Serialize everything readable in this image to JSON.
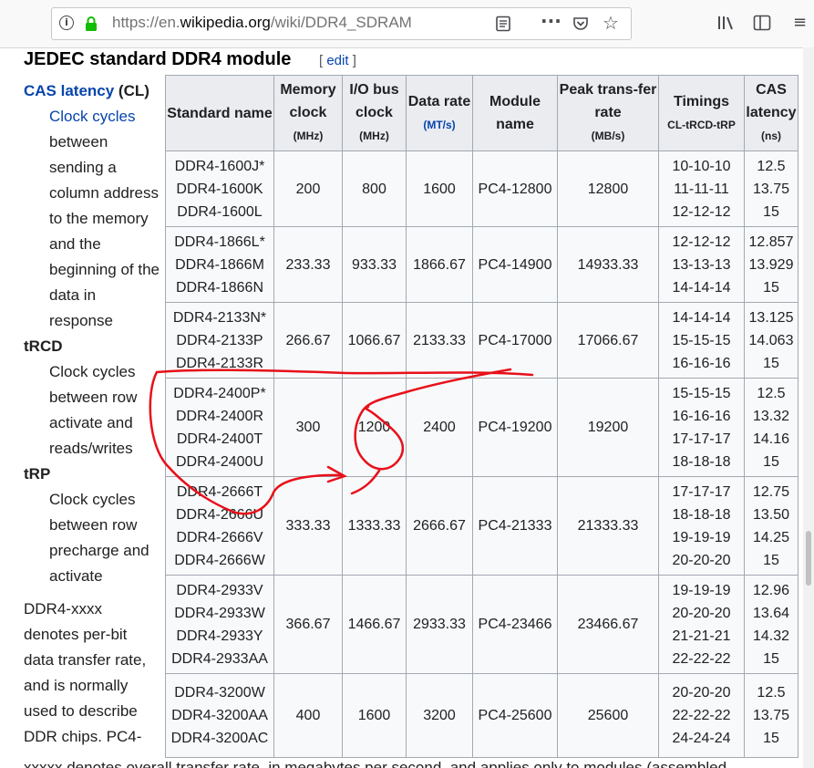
{
  "browser": {
    "url_prefix": "https://en.",
    "url_domain": "wikipedia.org",
    "url_path": "/wiki/DDR4_SDRAM"
  },
  "section": {
    "title": "JEDEC standard DDR4 module",
    "edit_open": "[ ",
    "edit_label": "edit",
    "edit_close": " ]"
  },
  "sidebar": {
    "cas_link": "CAS latency",
    "cas_abbr": " (CL)",
    "cas_desc_link": "Clock cycles",
    "cas_desc": "between sending a column address to the memory and the beginning of the data in response",
    "trcd_term": "tRCD",
    "trcd_desc": "Clock cycles between row activate and reads/writes",
    "trp_term": "tRP",
    "trp_desc": "Clock cycles between row precharge and activate",
    "note": "DDR4-xxxx denotes per-bit data transfer rate, and is normally used to describe DDR chips. PC4-",
    "bottom_cut": "xxxxx denotes overall transfer rate, in megabytes per second, and applies only to modules (assembled"
  },
  "table": {
    "headers": [
      {
        "label": "Standard name",
        "unit": ""
      },
      {
        "label": "Memory clock",
        "unit": "(MHz)"
      },
      {
        "label": "I/O bus clock",
        "unit": "(MHz)"
      },
      {
        "label": "Data rate",
        "unit": "(MT/s)"
      },
      {
        "label": "Module name",
        "unit": ""
      },
      {
        "label": "Peak trans-fer rate",
        "unit": "(MB/s)"
      },
      {
        "label": "Timings",
        "unit": "CL-tRCD-tRP"
      },
      {
        "label": "CAS latency",
        "unit": "(ns)"
      }
    ],
    "rows": [
      {
        "standard": [
          "DDR4-1600J*",
          "DDR4-1600K",
          "DDR4-1600L"
        ],
        "memory_clock": "200",
        "io_clock": "800",
        "data_rate": "1600",
        "module": "PC4-12800",
        "peak": "12800",
        "timings": [
          "10-10-10",
          "11-11-11",
          "12-12-12"
        ],
        "cas": [
          "12.5",
          "13.75",
          "15"
        ]
      },
      {
        "standard": [
          "DDR4-1866L*",
          "DDR4-1866M",
          "DDR4-1866N"
        ],
        "memory_clock": "233.33",
        "io_clock": "933.33",
        "data_rate": "1866.67",
        "module": "PC4-14900",
        "peak": "14933.33",
        "timings": [
          "12-12-12",
          "13-13-13",
          "14-14-14"
        ],
        "cas": [
          "12.857",
          "13.929",
          "15"
        ]
      },
      {
        "standard": [
          "DDR4-2133N*",
          "DDR4-2133P",
          "DDR4-2133R"
        ],
        "memory_clock": "266.67",
        "io_clock": "1066.67",
        "data_rate": "2133.33",
        "module": "PC4-17000",
        "peak": "17066.67",
        "timings": [
          "14-14-14",
          "15-15-15",
          "16-16-16"
        ],
        "cas": [
          "13.125",
          "14.063",
          "15"
        ]
      },
      {
        "standard": [
          "DDR4-2400P*",
          "DDR4-2400R",
          "DDR4-2400T",
          "DDR4-2400U"
        ],
        "memory_clock": "300",
        "io_clock": "1200",
        "data_rate": "2400",
        "module": "PC4-19200",
        "peak": "19200",
        "timings": [
          "15-15-15",
          "16-16-16",
          "17-17-17",
          "18-18-18"
        ],
        "cas": [
          "12.5",
          "13.32",
          "14.16",
          "15"
        ]
      },
      {
        "standard": [
          "DDR4-2666T",
          "DDR4-2666U",
          "DDR4-2666V",
          "DDR4-2666W"
        ],
        "memory_clock": "333.33",
        "io_clock": "1333.33",
        "data_rate": "2666.67",
        "module": "PC4-21333",
        "peak": "21333.33",
        "timings": [
          "17-17-17",
          "18-18-18",
          "19-19-19",
          "20-20-20"
        ],
        "cas": [
          "12.75",
          "13.50",
          "14.25",
          "15"
        ]
      },
      {
        "standard": [
          "DDR4-2933V",
          "DDR4-2933W",
          "DDR4-2933Y",
          "DDR4-2933AA"
        ],
        "memory_clock": "366.67",
        "io_clock": "1466.67",
        "data_rate": "2933.33",
        "module": "PC4-23466",
        "peak": "23466.67",
        "timings": [
          "19-19-19",
          "20-20-20",
          "21-21-21",
          "22-22-22"
        ],
        "cas": [
          "12.96",
          "13.64",
          "14.32",
          "15"
        ]
      },
      {
        "standard": [
          "DDR4-3200W",
          "DDR4-3200AA",
          "DDR4-3200AC"
        ],
        "memory_clock": "400",
        "io_clock": "1600",
        "data_rate": "3200",
        "module": "PC4-25600",
        "peak": "25600",
        "timings": [
          "20-20-20",
          "22-22-22",
          "24-24-24"
        ],
        "cas": [
          "12.5",
          "13.75",
          "15"
        ]
      }
    ]
  },
  "icons": {
    "info": "info-icon",
    "lock": "lock-icon",
    "reader": "reader-view-icon",
    "more": "more-actions-icon",
    "pocket": "pocket-icon",
    "star": "bookmark-star-icon",
    "library": "library-icon",
    "sidebar": "sidebar-toggle-icon"
  },
  "colors": {
    "link": "#0645ad",
    "annotation": "#e8101a",
    "header_bg": "#eaecf0"
  }
}
